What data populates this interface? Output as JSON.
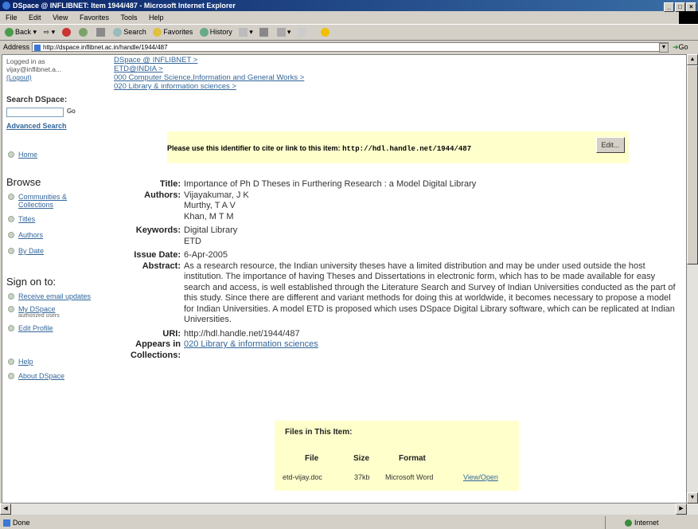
{
  "window": {
    "title": "DSpace @ INFLIBNET: Item 1944/487 - Microsoft Internet Explorer"
  },
  "menu": [
    "File",
    "Edit",
    "View",
    "Favorites",
    "Tools",
    "Help"
  ],
  "toolbar": {
    "back": "Back",
    "search": "Search",
    "favorites": "Favorites",
    "history": "History"
  },
  "address": {
    "label": "Address",
    "url": "http://dspace.inflibnet.ac.in/handle/1944/487",
    "go": "Go"
  },
  "sidebar": {
    "logged_in": "Logged in as vijay@inflibnet.a...",
    "logout": "(Logout)",
    "search_title": "Search DSpace:",
    "go_label": "Go",
    "advanced_search": "Advanced Search",
    "home": "Home",
    "browse_title": "Browse",
    "communities": "Communities & Collections",
    "titles": "Titles",
    "authors": "Authors",
    "by_date": "By Date",
    "signon_title": "Sign on to:",
    "receive_email": "Receive email updates",
    "my_dspace": "My DSpace",
    "my_dspace_note": "authorized users",
    "edit_profile": "Edit Profile",
    "help": "Help",
    "about": "About DSpace"
  },
  "breadcrumbs": [
    "DSpace @ INFLIBNET >",
    "ETD@INDIA >",
    "000 Computer Science,Information and General Works >",
    "020 Library & information sciences >"
  ],
  "cite": {
    "text": "Please use this identifier to cite or link to this item: ",
    "url": "http://hdl.handle.net/1944/487",
    "edit": "Edit..."
  },
  "item": {
    "title_label": "Title:",
    "title": "Importance of Ph D Theses in Furthering Research : a Model Digital Library",
    "authors_label": "Authors:",
    "authors": [
      "Vijayakumar, J K",
      "Murthy, T A V",
      "Khan, M T M"
    ],
    "keywords_label": "Keywords:",
    "keywords": [
      "Digital Library",
      "ETD"
    ],
    "issue_date_label": "Issue Date:",
    "issue_date": "6-Apr-2005",
    "abstract_label": "Abstract:",
    "abstract": "As a research resource, the Indian university theses have a limited distribution and may be under used outside the host institution. The importance of having Theses and Dissertations in electronic form, which has to be made available for easy search and access, is well established through the Literature Search and Survey of Indian Universities conducted as the part of this study. Since there are different and variant methods for doing this at worldwide, it becomes necessary to propose a model for Indian Universities. A model ETD is proposed which uses DSpace Digital Library software, which can be replicated at Indian Universities.",
    "uri_label": "URI:",
    "uri": "http://hdl.handle.net/1944/487",
    "appears_label_1": "Appears in",
    "appears_label_2": "Collections:",
    "collection": "020 Library & information sciences"
  },
  "files": {
    "title": "Files in This Item:",
    "head_file": "File",
    "head_size": "Size",
    "head_format": "Format",
    "file": "etd-vijay.doc",
    "size": "37kb",
    "format": "Microsoft Word",
    "action": "View/Open"
  },
  "status": {
    "left": "Done",
    "zone": "Internet"
  }
}
